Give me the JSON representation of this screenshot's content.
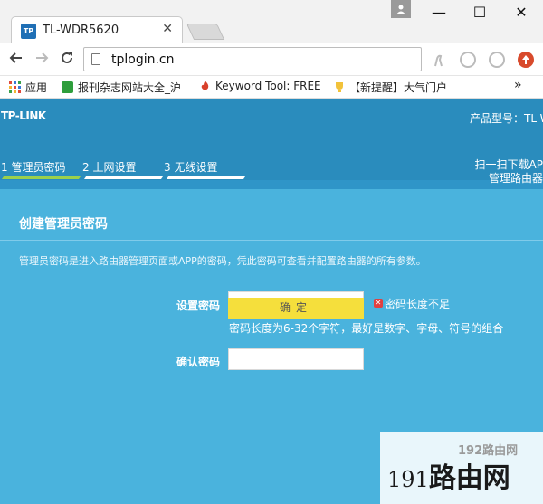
{
  "browser": {
    "tab_title": "TL-WDR5620",
    "tab_favicon": "TP",
    "tab_close": "✕",
    "url": "tplogin.cn",
    "window_controls": {
      "minimize": "—",
      "maximize": "☐",
      "close": "✕"
    },
    "bookmarks": [
      {
        "label": "应用",
        "icon": "apps-grid-icon"
      },
      {
        "label": "报刊杂志网站大全_沪",
        "icon": "green-check-icon"
      },
      {
        "label": "Keyword Tool: FREE",
        "icon": "flame-icon"
      },
      {
        "label": "【新提醒】大气门户",
        "icon": "trophy-icon"
      }
    ],
    "bookmarks_more": "»"
  },
  "router": {
    "logo": "TP-LINK",
    "model_label": "产品型号：TL-W",
    "steps": [
      {
        "label": "1 管理员密码",
        "active": true
      },
      {
        "label": "2 上网设置",
        "active": false
      },
      {
        "label": "3 无线设置",
        "active": false
      }
    ],
    "qr_lines": [
      "扫一扫下载AP",
      "管理路由器"
    ],
    "panel": {
      "title": "创建管理员密码",
      "description": "管理员密码是进入路由器管理页面或APP的密码，凭此密码可查看并配置路由器的所有参数。",
      "password_label": "设置密码",
      "password_value": "",
      "error_text": "密码长度不足",
      "hint": "密码长度为6-32个字符，最好是数字、字母、符号的组合",
      "confirm_label": "确认密码",
      "confirm_value": "",
      "submit_label": "确定"
    }
  },
  "watermark": {
    "small": "192路由网",
    "number": "191",
    "text": "路由网"
  },
  "colors": {
    "router_bg": "#2f95c8",
    "panel_bg": "#4ab3dd",
    "active_step": "#9bd04c",
    "button": "#f5df3c",
    "error": "#e04040"
  }
}
